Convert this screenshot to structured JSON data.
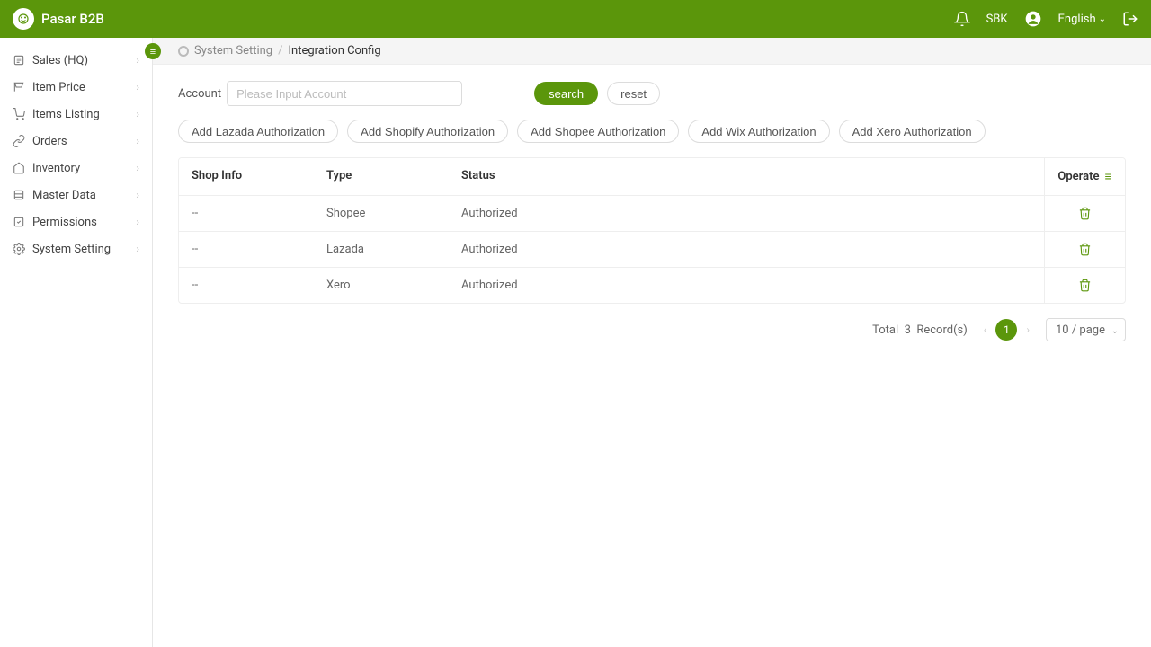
{
  "header": {
    "app_name": "Pasar B2B",
    "user_code": "SBK",
    "language": "English"
  },
  "sidebar": {
    "items": [
      {
        "label": "Sales (HQ)",
        "icon": "sales"
      },
      {
        "label": "Item Price",
        "icon": "price"
      },
      {
        "label": "Items Listing",
        "icon": "listing"
      },
      {
        "label": "Orders",
        "icon": "orders"
      },
      {
        "label": "Inventory",
        "icon": "inventory"
      },
      {
        "label": "Master Data",
        "icon": "master"
      },
      {
        "label": "Permissions",
        "icon": "permissions"
      },
      {
        "label": "System Setting",
        "icon": "settings"
      }
    ]
  },
  "breadcrumb": {
    "parent": "System Setting",
    "current": "Integration Config"
  },
  "filter": {
    "account_label": "Account",
    "account_placeholder": "Please Input Account",
    "search_label": "search",
    "reset_label": "reset"
  },
  "auth_buttons": [
    "Add Lazada Authorization",
    "Add Shopify Authorization",
    "Add Shopee Authorization",
    "Add Wix Authorization",
    "Add Xero Authorization"
  ],
  "table": {
    "headers": {
      "shop_info": "Shop Info",
      "type": "Type",
      "status": "Status",
      "operate": "Operate"
    },
    "rows": [
      {
        "shop": "--",
        "type": "Shopee",
        "status": "Authorized"
      },
      {
        "shop": "--",
        "type": "Lazada",
        "status": "Authorized"
      },
      {
        "shop": "--",
        "type": "Xero",
        "status": "Authorized"
      }
    ]
  },
  "pagination": {
    "total_label": "Total",
    "total_count": "3",
    "records_label": "Record(s)",
    "current_page": "1",
    "per_page_label": "10 / page"
  }
}
